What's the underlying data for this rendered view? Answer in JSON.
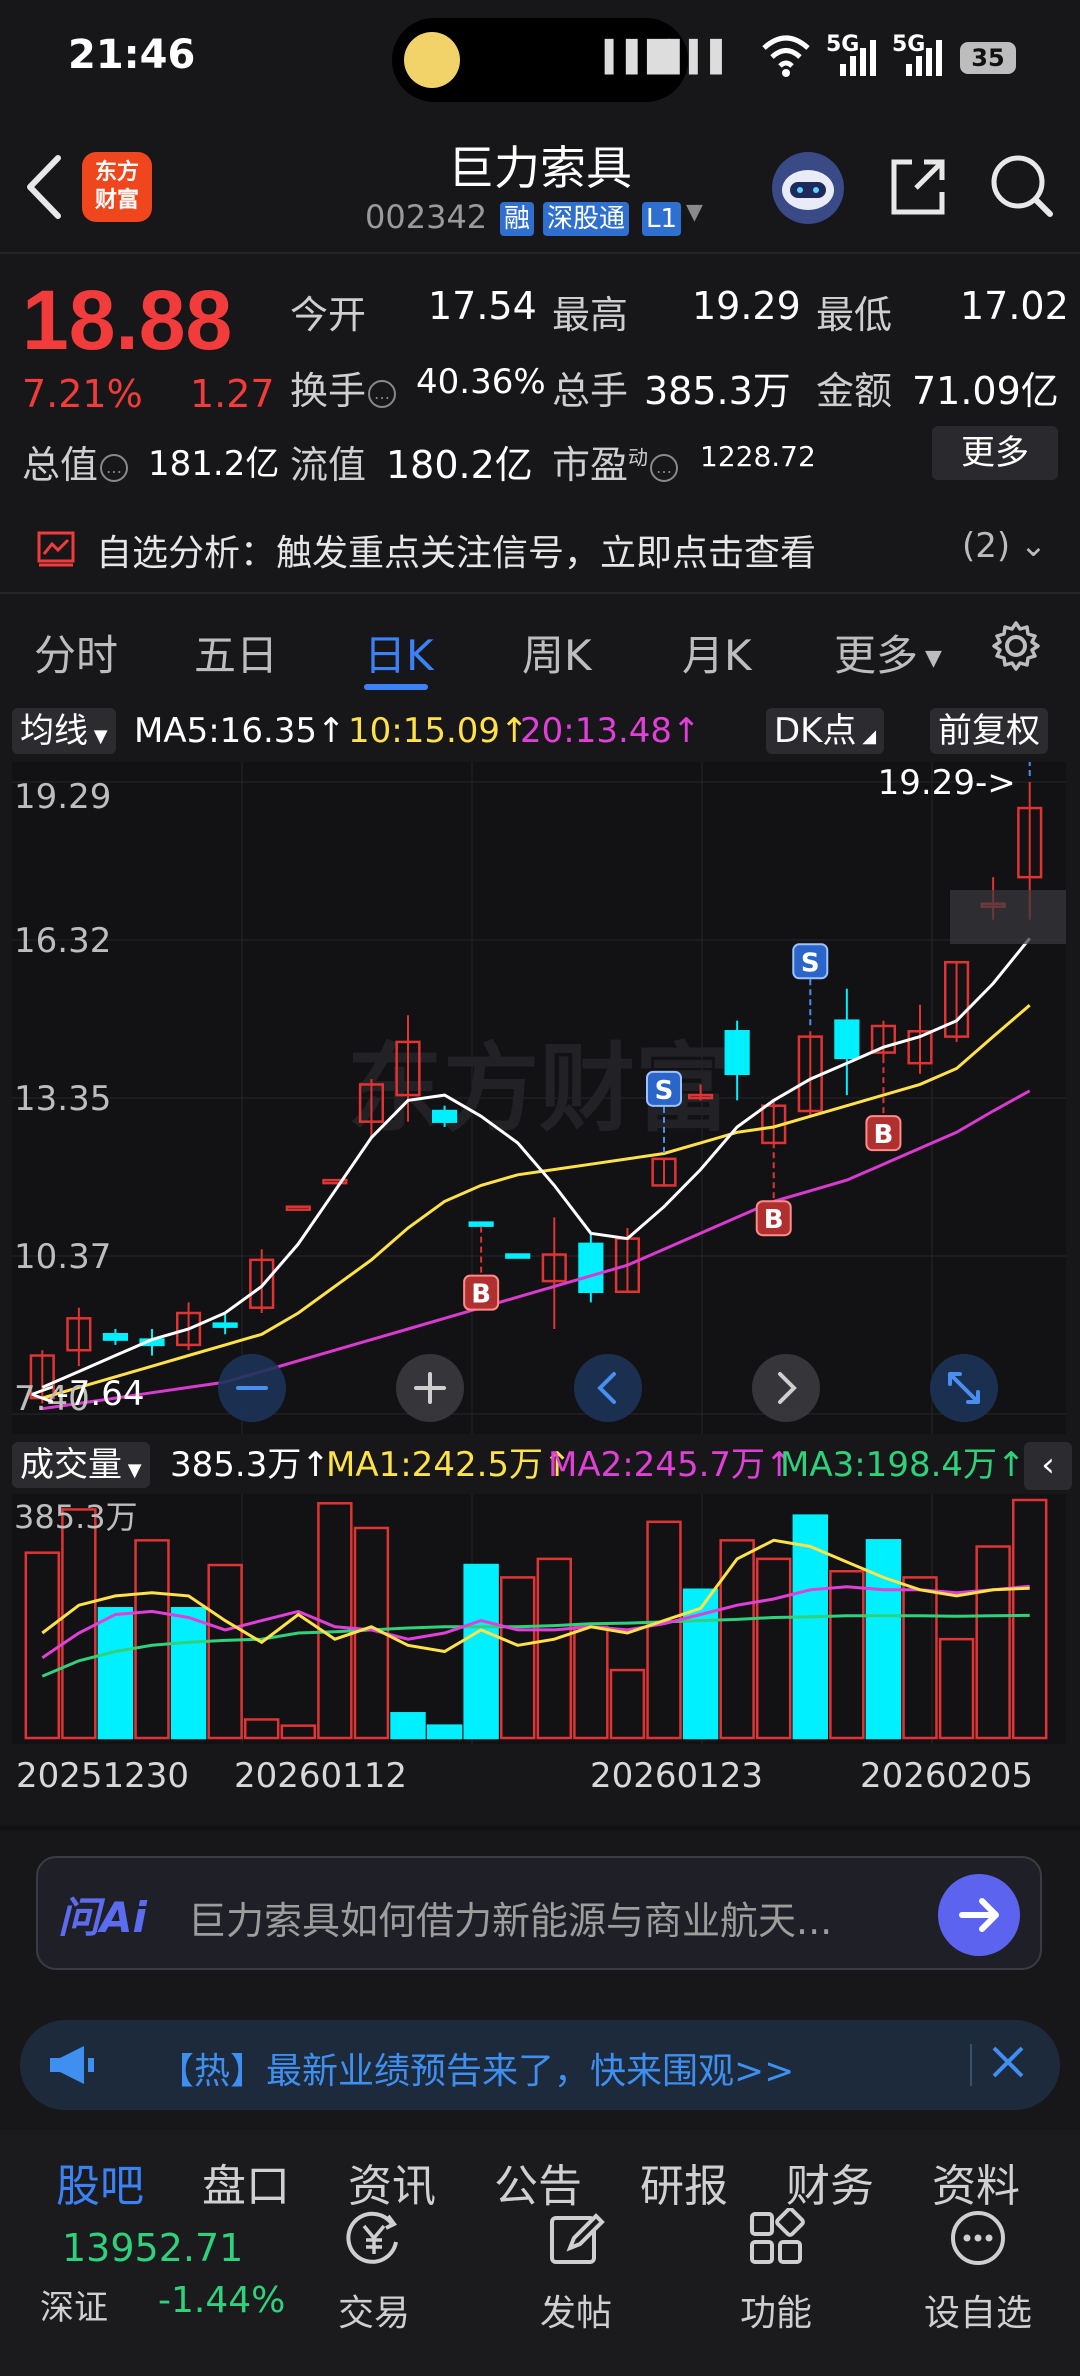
{
  "status": {
    "time": "21:46",
    "sig1": "5G",
    "sig2": "5G",
    "battery": "35"
  },
  "header": {
    "logo": [
      "东方",
      "财富"
    ],
    "title": "巨力索具",
    "code": "002342",
    "tags": [
      "融",
      "深股通",
      "L1"
    ]
  },
  "quote": {
    "price": "18.88",
    "pct": "7.21%",
    "change": "1.27",
    "open_label": "今开",
    "open": "17.54",
    "high_label": "最高",
    "high": "19.29",
    "low_label": "最低",
    "low": "17.02",
    "turnover_label": "换手",
    "turnover": "40.36%",
    "volume_label": "总手",
    "volume": "385.3万",
    "amount_label": "金额",
    "amount": "71.09亿",
    "mcap_label": "总值",
    "mcap": "181.2亿",
    "float_label": "流值",
    "float": "180.2亿",
    "pe_label": "市盈",
    "pe_sup": "动",
    "pe": "1228.72",
    "more": "更多"
  },
  "analysis": {
    "text": "自选分析：触发重点关注信号，立即点击查看",
    "count": "(2)"
  },
  "ktabs": [
    "分时",
    "五日",
    "日K",
    "周K",
    "月K",
    "更多"
  ],
  "ma": {
    "selector": "均线",
    "ma5": "MA5:16.35",
    "ma10": "10:15.09",
    "ma20": "20:13.48",
    "dk": "DK点",
    "fq": "前复权"
  },
  "volume_row": {
    "selector": "成交量",
    "vol": "385.3万",
    "ma1": "MA1:242.5万",
    "ma2": "MA2:245.7万",
    "ma3": "MA3:198.4万"
  },
  "chart_data": {
    "type": "candlestick",
    "y_ticks": [
      "19.29",
      "16.32",
      "13.35",
      "10.37",
      "7.40"
    ],
    "ylim": [
      7.4,
      19.29
    ],
    "high_marker": "19.29->",
    "low_marker": "<-7.64",
    "candles": [
      {
        "o": 7.7,
        "c": 8.5,
        "h": 8.6,
        "l": 7.6,
        "up": true
      },
      {
        "o": 8.6,
        "c": 9.2,
        "h": 9.4,
        "l": 8.3,
        "up": true
      },
      {
        "o": 8.9,
        "c": 8.8,
        "h": 9.0,
        "l": 8.7,
        "up": false
      },
      {
        "o": 8.7,
        "c": 8.8,
        "h": 9.0,
        "l": 8.5,
        "up": false
      },
      {
        "o": 8.7,
        "c": 9.3,
        "h": 9.5,
        "l": 8.6,
        "up": true
      },
      {
        "o": 9.1,
        "c": 9.05,
        "h": 9.3,
        "l": 8.9,
        "up": false
      },
      {
        "o": 9.4,
        "c": 10.3,
        "h": 10.5,
        "l": 9.3,
        "up": true
      },
      {
        "o": 11.3,
        "c": 11.3,
        "h": 11.3,
        "l": 11.3,
        "up": true
      },
      {
        "o": 11.8,
        "c": 11.8,
        "h": 11.8,
        "l": 11.8,
        "up": true
      },
      {
        "o": 12.9,
        "c": 13.6,
        "h": 13.7,
        "l": 12.6,
        "up": true
      },
      {
        "o": 13.4,
        "c": 14.4,
        "h": 14.9,
        "l": 12.9,
        "up": true
      },
      {
        "o": 13.1,
        "c": 12.9,
        "h": 13.2,
        "l": 12.8,
        "up": false
      },
      {
        "o": 11.0,
        "c": 11.0,
        "h": 11.0,
        "l": 11.0,
        "up": false
      },
      {
        "o": 10.4,
        "c": 10.4,
        "h": 10.4,
        "l": 10.4,
        "up": false
      },
      {
        "o": 10.4,
        "c": 9.9,
        "h": 11.1,
        "l": 9.0,
        "up": true
      },
      {
        "o": 10.6,
        "c": 9.7,
        "h": 10.8,
        "l": 9.5,
        "up": false
      },
      {
        "o": 9.7,
        "c": 10.7,
        "h": 10.9,
        "l": 9.7,
        "up": true
      },
      {
        "o": 11.7,
        "c": 12.2,
        "h": 12.2,
        "l": 11.7,
        "up": true
      },
      {
        "o": 13.4,
        "c": 13.4,
        "h": 13.6,
        "l": 13.3,
        "up": true
      },
      {
        "o": 13.8,
        "c": 14.6,
        "h": 14.8,
        "l": 13.3,
        "up": false
      },
      {
        "o": 12.5,
        "c": 13.2,
        "h": 13.3,
        "l": 12.4,
        "up": true
      },
      {
        "o": 13.1,
        "c": 14.5,
        "h": 14.6,
        "l": 13.0,
        "up": true
      },
      {
        "o": 14.1,
        "c": 14.8,
        "h": 15.4,
        "l": 13.4,
        "up": false
      },
      {
        "o": 14.2,
        "c": 14.7,
        "h": 14.8,
        "l": 14.0,
        "up": true
      },
      {
        "o": 14.0,
        "c": 14.6,
        "h": 15.1,
        "l": 13.8,
        "up": true
      },
      {
        "o": 14.5,
        "c": 15.9,
        "h": 15.9,
        "l": 14.4,
        "up": true
      },
      {
        "o": 17.0,
        "c": 17.0,
        "h": 17.5,
        "l": 16.7,
        "up": true
      },
      {
        "o": 17.5,
        "c": 18.8,
        "h": 19.29,
        "l": 16.7,
        "up": true
      }
    ],
    "ma5": [
      7.9,
      8.2,
      8.5,
      8.8,
      9.0,
      9.3,
      9.8,
      10.6,
      11.6,
      12.6,
      13.3,
      13.4,
      13.0,
      12.5,
      11.7,
      10.8,
      10.7,
      11.3,
      12.0,
      12.8,
      13.3,
      13.7,
      14.0,
      14.3,
      14.5,
      14.8,
      15.5,
      16.35
    ],
    "ma10": [
      7.7,
      7.9,
      8.1,
      8.3,
      8.5,
      8.7,
      8.9,
      9.3,
      9.8,
      10.3,
      10.9,
      11.4,
      11.7,
      11.9,
      12.0,
      12.1,
      12.2,
      12.3,
      12.5,
      12.7,
      12.8,
      13.0,
      13.2,
      13.4,
      13.6,
      13.9,
      14.5,
      15.09
    ],
    "ma20": [
      7.5,
      7.6,
      7.7,
      7.8,
      7.9,
      8.0,
      8.2,
      8.4,
      8.6,
      8.8,
      9.0,
      9.2,
      9.4,
      9.6,
      9.8,
      10.0,
      10.2,
      10.5,
      10.8,
      11.1,
      11.4,
      11.6,
      11.8,
      12.1,
      12.4,
      12.7,
      13.1,
      13.48
    ],
    "signals": [
      {
        "i": 12,
        "kind": "B"
      },
      {
        "i": 17,
        "kind": "S"
      },
      {
        "i": 20,
        "kind": "B"
      },
      {
        "i": 21,
        "kind": "S"
      },
      {
        "i": 23,
        "kind": "B"
      },
      {
        "i": 27,
        "kind": "S"
      }
    ],
    "volume": {
      "max_label": "385.3万",
      "values": [
        300,
        370,
        210,
        320,
        210,
        280,
        30,
        20,
        380,
        340,
        40,
        20,
        280,
        260,
        290,
        180,
        110,
        350,
        240,
        320,
        290,
        360,
        270,
        320,
        260,
        160,
        310,
        385.3
      ],
      "cyan": [
        false,
        false,
        true,
        false,
        true,
        false,
        false,
        false,
        false,
        false,
        true,
        true,
        true,
        false,
        false,
        false,
        false,
        false,
        true,
        false,
        false,
        true,
        false,
        true,
        false,
        false,
        false,
        false
      ],
      "ma1": [
        170,
        215,
        230,
        235,
        230,
        190,
        155,
        200,
        160,
        180,
        150,
        140,
        175,
        150,
        160,
        180,
        170,
        190,
        210,
        290,
        320,
        310,
        285,
        260,
        240,
        230,
        240,
        242.5
      ],
      "ma2": [
        130,
        170,
        200,
        205,
        195,
        175,
        190,
        205,
        180,
        175,
        160,
        170,
        190,
        175,
        175,
        180,
        175,
        185,
        200,
        215,
        225,
        240,
        245,
        240,
        240,
        235,
        240,
        245.7
      ],
      "ma3": [
        100,
        125,
        140,
        150,
        155,
        158,
        160,
        170,
        172,
        175,
        178,
        180,
        180,
        180,
        182,
        185,
        186,
        188,
        190,
        192,
        195,
        196,
        198,
        198,
        198,
        197,
        198,
        198.4
      ]
    },
    "x_labels": [
      "20251230",
      "20260112",
      "20260123",
      "20260205"
    ],
    "watermark": "东方财富"
  },
  "ai": {
    "logo": "问Ai",
    "text": "巨力索具如何借力新能源与商业航天..."
  },
  "banner": {
    "text": "【热】最新业绩预告来了，快来围观>>"
  },
  "bottom_tabs": [
    "股吧",
    "盘口",
    "资讯",
    "公告",
    "研报",
    "财务",
    "资料"
  ],
  "index": {
    "value": "13952.71",
    "name": "深证",
    "pct": "-1.44%"
  },
  "nav": [
    "交易",
    "发帖",
    "功能",
    "设自选"
  ]
}
